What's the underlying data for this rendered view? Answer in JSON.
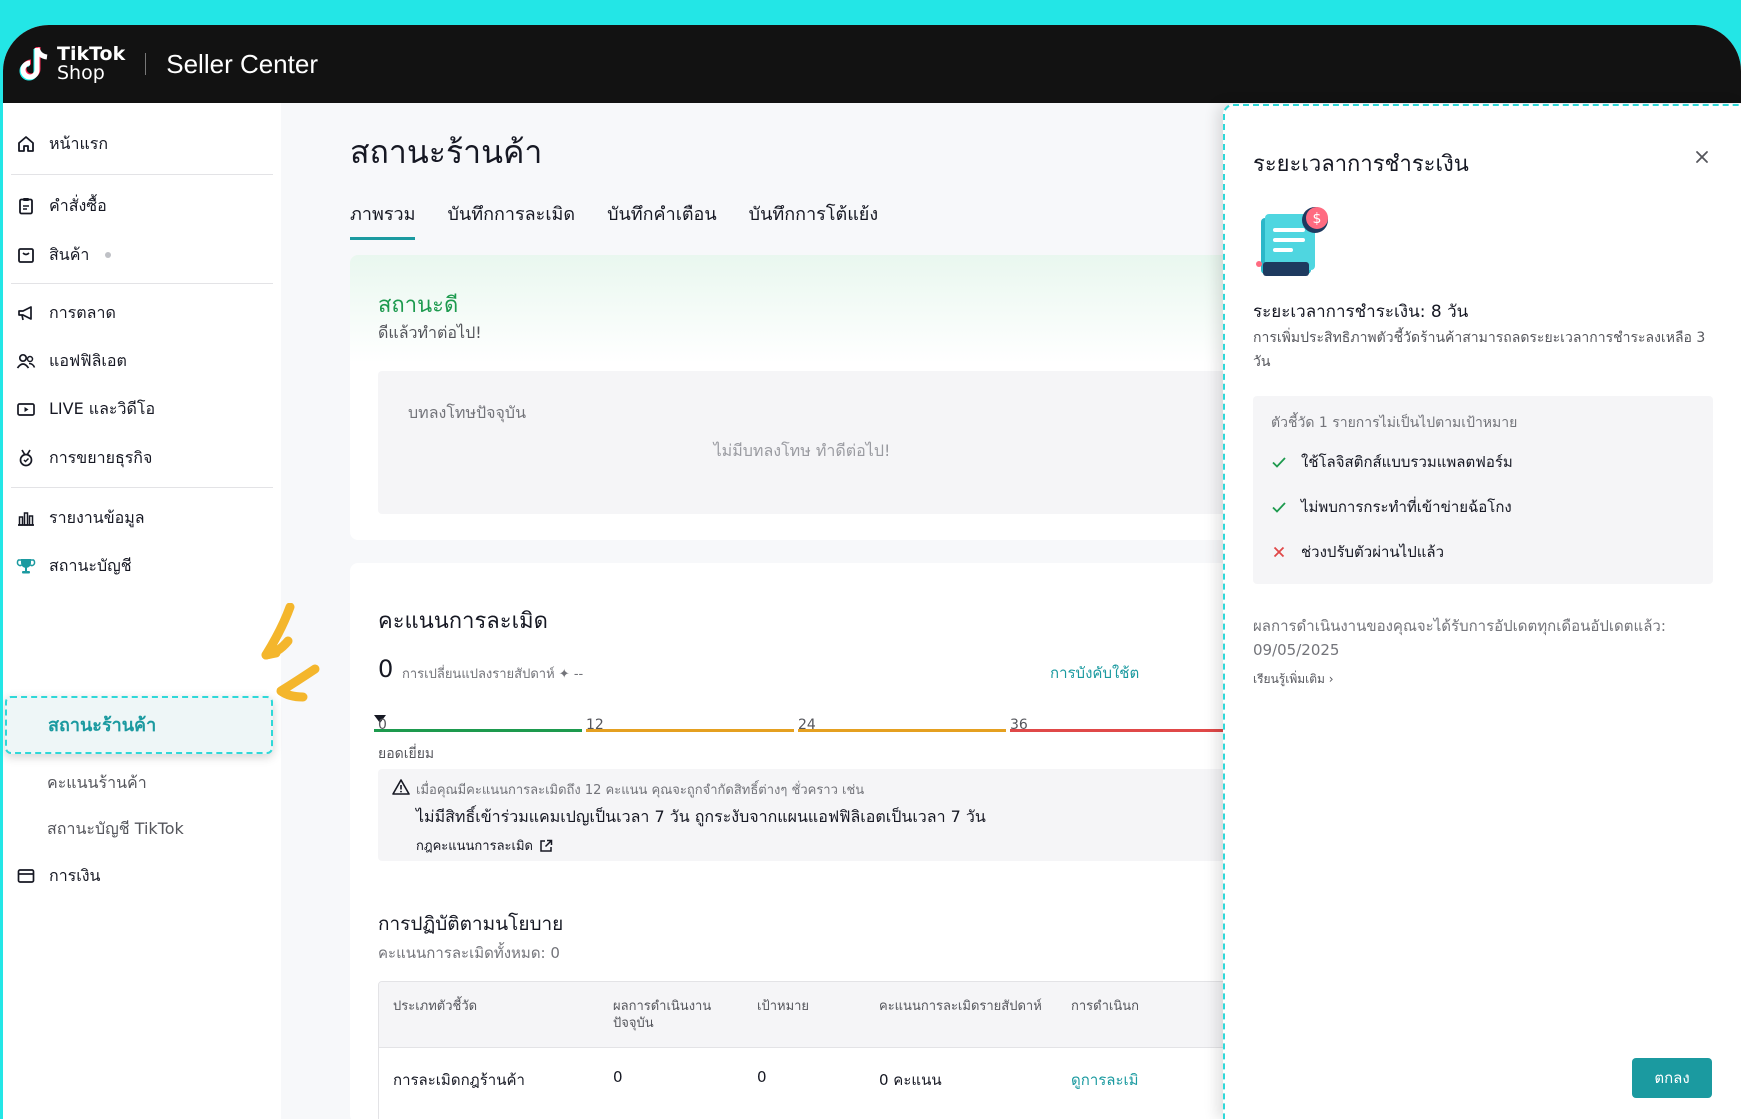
{
  "header": {
    "logo_line1": "TikTok",
    "logo_line2": "Shop",
    "brand": "Seller Center"
  },
  "sidebar": {
    "items": [
      {
        "label": "หน้าแรก",
        "icon": "home-icon"
      },
      {
        "label": "คำสั่งซื้อ",
        "icon": "clipboard-icon"
      },
      {
        "label": "สินค้า",
        "icon": "box-icon"
      },
      {
        "label": "การตลาด",
        "icon": "megaphone-icon"
      },
      {
        "label": "แอฟฟิลิเอต",
        "icon": "users-icon"
      },
      {
        "label": "LIVE และวิดีโอ",
        "icon": "video-icon"
      },
      {
        "label": "การขยายธุรกิจ",
        "icon": "medal-icon"
      },
      {
        "label": "รายงานข้อมูล",
        "icon": "bar-chart-icon"
      },
      {
        "label": "สถานะบัญชี",
        "icon": "trophy-icon"
      }
    ],
    "sub_items": {
      "active": "สถานะร้านค้า",
      "score": "คะแนนร้านค้า",
      "tiktok": "สถานะบัญชี TikTok"
    },
    "finance": {
      "label": "การเงิน",
      "icon": "wallet-icon"
    }
  },
  "main": {
    "title": "สถานะร้านค้า",
    "tabs": [
      "ภาพรวม",
      "บันทึกการละเมิด",
      "บันทึกคำเตือน",
      "บันทึกการโต้แย้ง"
    ],
    "status": {
      "label": "สถานะดี",
      "sub": "ดีแล้วทำต่อไป!",
      "penalty_title": "บทลงโทษปัจจุบัน",
      "penalty_empty": "ไม่มีบทลงโทษ ทำดีต่อไป!"
    },
    "violation": {
      "title": "คะแนนการละเมิด",
      "score": "0",
      "weekly_change": "การเปลี่ยนแปลงรายสัปดาห์ ✦ --",
      "enforce_link": "การบังคับใช้ต",
      "ticks": [
        "0",
        "12",
        "24",
        "36"
      ],
      "excellent": "ยอดเยี่ยม",
      "warning_line1": "เมื่อคุณมีคะแนนการละเมิดถึง 12 คะแนน คุณจะถูกจำกัดสิทธิ์ต่างๆ ชั่วคราว เช่น",
      "warning_line2": "ไม่มีสิทธิ์เข้าร่วมแคมเปญเป็นเวลา 7 วัน ถูกระงับจากแผนแอฟฟิลิเอตเป็นเวลา 7 วัน",
      "rules_link": "กฎคะแนนการละเมิด"
    },
    "policy": {
      "title": "การปฏิบัติตามนโยบาย",
      "total": "คะแนนการละเมิดทั้งหมด: 0",
      "headers": [
        "ประเภทตัวชี้วัด",
        "ผลการดำเนินงาน\nปัจจุบัน",
        "เป้าหมาย",
        "คะแนนการละเมิดรายสัปดาห์",
        "การดำเนินก"
      ],
      "rows": [
        {
          "type": "การละเมิดกฎร้านค้า",
          "current": "0",
          "target": "0",
          "weekly": "0 คะแนน",
          "action": "ดูการละเมิ"
        }
      ]
    }
  },
  "drawer": {
    "title": "ระยะเวลาการชำระเงิน",
    "heading": "ระยะเวลาการชำระเงิน: 8 วัน",
    "desc": "การเพิ่มประสิทธิภาพตัวชี้วัดร้านค้าสามารถลดระยะเวลาการชำระลงเหลือ 3 วัน",
    "box_title": "ตัวชี้วัด 1 รายการไม่เป็นไปตามเป้าหมาย",
    "checks": [
      {
        "label": "ใช้โลจิสติกส์แบบรวมแพลตฟอร์ม",
        "ok": true
      },
      {
        "label": "ไม่พบการกระทำที่เข้าข่ายฉ้อโกง",
        "ok": true
      },
      {
        "label": "ช่วงปรับตัวผ่านไปแล้ว",
        "ok": false
      }
    ],
    "update": "ผลการดำเนินงานของคุณจะได้รับการอัปเดตทุกเดือนอัปเดตแล้ว: 09/05/2025",
    "learn_more": "เรียนรู้เพิ่มเติม ›",
    "ok_button": "ตกลง"
  },
  "colors": {
    "accent": "#1b9aa0",
    "good": "#1d9a4e",
    "frame": "#23e6e6",
    "bar_green": "#1d9a4e",
    "bar_orange": "#e5a020",
    "bar_red": "#e04848"
  }
}
